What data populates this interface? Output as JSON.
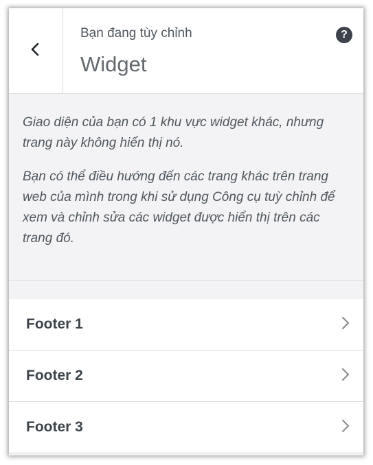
{
  "header": {
    "subtitle": "Bạn đang tùy chỉnh",
    "title": "Widget",
    "back_icon": "chevron-left-icon",
    "help_label": "?"
  },
  "description": {
    "paragraph1": "Giao diện của bạn có 1 khu vực widget khác, nhưng trang này không hiển thị nó.",
    "paragraph2": "Bạn có thể điều hướng đến các trang khác trên trang web của mình trong khi sử dụng Công cụ tuỳ chỉnh để xem và chỉnh sửa các widget được hiển thị trên các trang đó."
  },
  "sections": [
    {
      "label": "Footer 1"
    },
    {
      "label": "Footer 2"
    },
    {
      "label": "Footer 3"
    }
  ],
  "colors": {
    "panel_bg": "#f3f3f5",
    "text": "#3c434a",
    "border": "#dcdcde"
  }
}
